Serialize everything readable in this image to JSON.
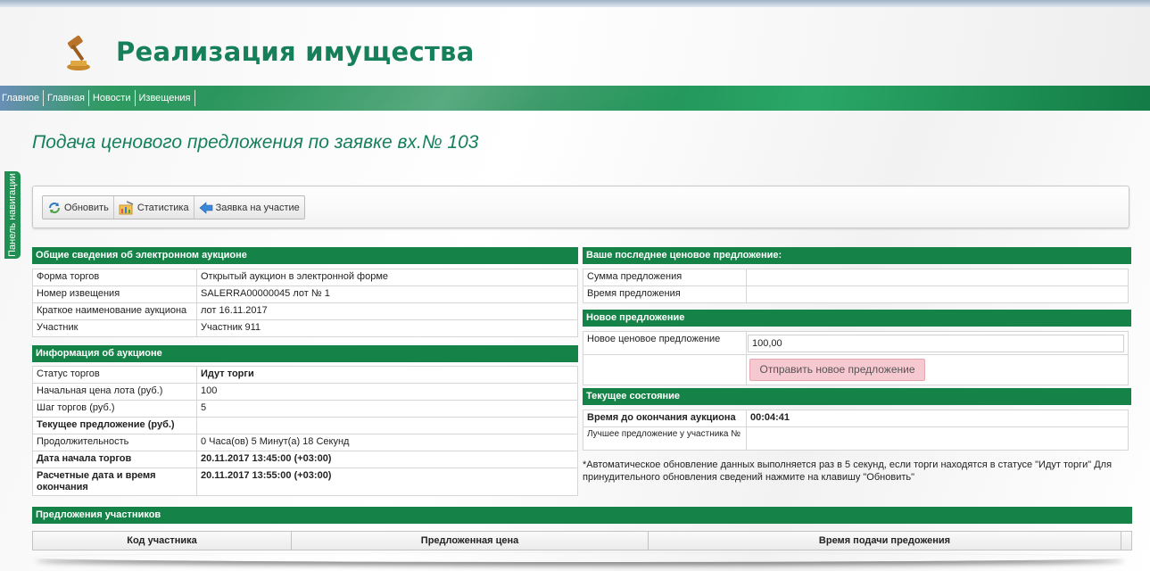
{
  "header": {
    "title": "Реализация имущества"
  },
  "nav": {
    "items": [
      {
        "label": "Главное"
      },
      {
        "label": "Главная"
      },
      {
        "label": "Новости"
      },
      {
        "label": "Извещения"
      }
    ]
  },
  "side_panel": {
    "label": "Панель навигации"
  },
  "page": {
    "title": "Подача ценового предложения по заявке вх.№ 103"
  },
  "toolbar": {
    "refresh_label": "Обновить",
    "stats_label": "Статистика",
    "application_label": "Заявка на участие"
  },
  "general_info": {
    "heading": "Общие сведения об электронном аукционе",
    "rows": [
      {
        "label": "Форма торгов",
        "value": "Открытый аукцион в электронной форме"
      },
      {
        "label": "Номер извещения",
        "value": "SALERRA00000045 лот № 1"
      },
      {
        "label": "Краткое наименование аукциона",
        "value": "лот 16.11.2017"
      },
      {
        "label": "Участник",
        "value": "Участник 911"
      }
    ]
  },
  "auction_info": {
    "heading": "Информация об аукционе",
    "rows": [
      {
        "label": "Статус торгов",
        "value": "Идут торги"
      },
      {
        "label": "Начальная цена лота (руб.)",
        "value": "100"
      },
      {
        "label": "Шаг торгов (руб.)",
        "value": "5"
      },
      {
        "label": "Текущее предложение (руб.)",
        "value": ""
      },
      {
        "label": "Продолжительность",
        "value": "0 Часа(ов) 5 Минут(а) 18 Секунд"
      },
      {
        "label": "Дата начала торгов",
        "value": "20.11.2017 13:45:00 (+03:00)"
      },
      {
        "label": "Расчетные дата и время окончания",
        "value": "20.11.2017 13:55:00 (+03:00)"
      }
    ]
  },
  "last_offer": {
    "heading": "Ваше последнее ценовое предложение:",
    "rows": [
      {
        "label": "Сумма предложения",
        "value": ""
      },
      {
        "label": "Время предложения",
        "value": ""
      }
    ]
  },
  "new_offer": {
    "heading": "Новое предложение",
    "label": "Новое ценовое предложение",
    "value": "100,00",
    "submit_label": "Отправить новое предложение"
  },
  "current_state": {
    "heading": "Текущее состояние",
    "rows": [
      {
        "label": "Время до окончания аукциона",
        "value": "00:04:41"
      },
      {
        "label": "Лучшее предложение у участника №",
        "value": ""
      }
    ],
    "note": "*Автоматическое обновление данных выполняется раз в 5 секунд, если торги находятся в статусе \"Идут торги\" Для принудительного обновления сведений нажмите на клавишу \"Обновить\""
  },
  "participants": {
    "heading": "Предложения участников",
    "columns": [
      "Код участника",
      "Предложенная цена",
      "Время подачи предожения"
    ]
  },
  "colors": {
    "brand_green": "#158347",
    "title_green": "#16805a",
    "send_button": "#f6c8d0"
  }
}
